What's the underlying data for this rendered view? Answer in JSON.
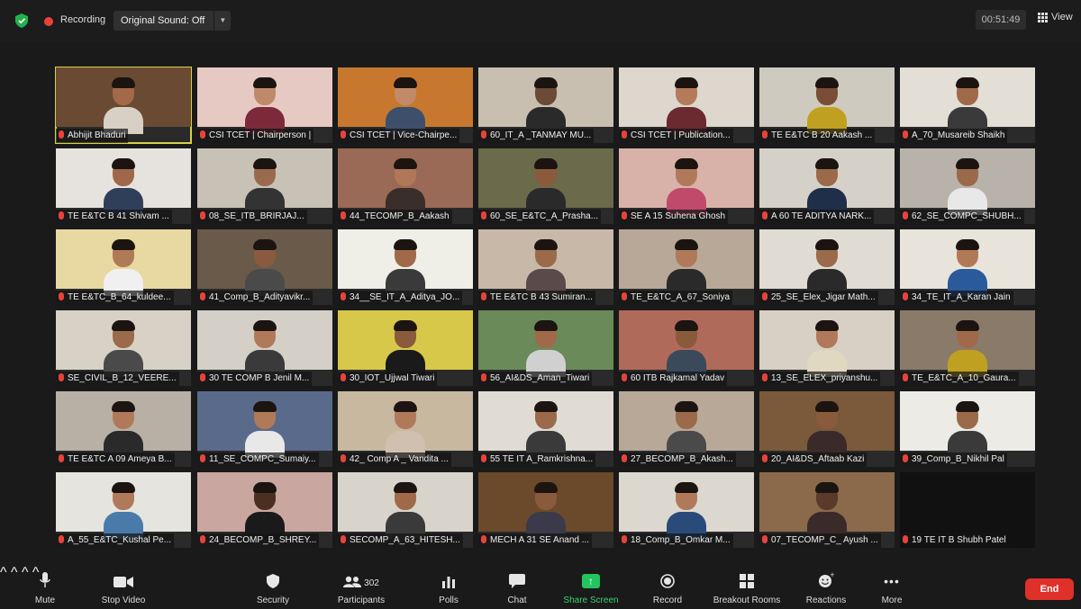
{
  "topbar": {
    "recording_label": "Recording",
    "original_sound": "Original Sound: Off",
    "timer": "00:51:49",
    "view_label": "View"
  },
  "participants": [
    {
      "name": "Abhijit Bhaduri",
      "bg": "#6b4a33",
      "skin": "#a36a48",
      "shirt": "#d8d0c4",
      "active": true
    },
    {
      "name": "CSI TCET | Chairperson |",
      "bg": "#e7c9c3",
      "skin": "#c08a6a",
      "shirt": "#7c2a3a"
    },
    {
      "name": "CSI TCET | Vice-Chairpe...",
      "bg": "#c7782e",
      "skin": "#c28a68",
      "shirt": "#3d4f6a"
    },
    {
      "name": "60_IT_A _TANMAY MU...",
      "bg": "#c9bfb0",
      "skin": "#6b4a38",
      "shirt": "#2a2a2a"
    },
    {
      "name": "CSI TCET | Publication...",
      "bg": "#ddd7ce",
      "skin": "#b47a5a",
      "shirt": "#6a2a30"
    },
    {
      "name": "TE E&TC B 20 Aakash ...",
      "bg": "#cfcac0",
      "skin": "#7a4e36",
      "shirt": "#c0a020"
    },
    {
      "name": "A_70_Musareib Shaikh",
      "bg": "#e3ded6",
      "skin": "#a06a4a",
      "shirt": "#3a3a3a"
    },
    {
      "name": "TE E&TC B 41 Shivam ...",
      "bg": "#e6e3de",
      "skin": "#a0684a",
      "shirt": "#2f3f5a"
    },
    {
      "name": "08_SE_ITB_BRIRJAJ...",
      "bg": "#c8c2b6",
      "skin": "#9a6a4e",
      "shirt": "#333"
    },
    {
      "name": "44_TECOMP_B_Aakash",
      "bg": "#9a6a56",
      "skin": "#b07858",
      "shirt": "#3a2e2a"
    },
    {
      "name": "60_SE_E&TC_A_Prasha...",
      "bg": "#6b6a4a",
      "skin": "#8a5a3c",
      "shirt": "#2a2a2a"
    },
    {
      "name": "SE A 15 Suhena Ghosh",
      "bg": "#d8b2a8",
      "skin": "#b07a5a",
      "shirt": "#c04a6a"
    },
    {
      "name": "A 60 TE ADITYA NARK...",
      "bg": "#d6d1c8",
      "skin": "#9a6a4a",
      "shirt": "#1f2f4a"
    },
    {
      "name": "62_SE_COMPC_SHUBH...",
      "bg": "#b8b2aa",
      "skin": "#9a6a4a",
      "shirt": "#e8e8e8"
    },
    {
      "name": "TE E&TC_B_64_kuldee...",
      "bg": "#e8d8a2",
      "skin": "#b07a54",
      "shirt": "#f0f0f0"
    },
    {
      "name": "41_Comp_B_Adityavikr...",
      "bg": "#6a5a4a",
      "skin": "#8a5a40",
      "shirt": "#4a4a4a"
    },
    {
      "name": "34__SE_IT_A_Aditya_JO...",
      "bg": "#efefe8",
      "skin": "#a06a4a",
      "shirt": "#3a3a3a"
    },
    {
      "name": "TE E&TC B 43 Sumiran...",
      "bg": "#c8b8a8",
      "skin": "#9a6a4a",
      "shirt": "#5a4a4a"
    },
    {
      "name": "TE_E&TC_A_67_Soniya",
      "bg": "#b8a898",
      "skin": "#b07a5a",
      "shirt": "#2a2a2a"
    },
    {
      "name": "25_SE_Elex_Jigar Math...",
      "bg": "#e0dcd4",
      "skin": "#9a6a4a",
      "shirt": "#2a2a2a"
    },
    {
      "name": "34_TE_IT_A_Karan Jain",
      "bg": "#e8e4dc",
      "skin": "#b07a56",
      "shirt": "#2a5a9a"
    },
    {
      "name": "SE_CIVIL_B_12_VEERE...",
      "bg": "#d8d2c6",
      "skin": "#9a6a4a",
      "shirt": "#4a4a4a"
    },
    {
      "name": "30 TE COMP B Jenil M...",
      "bg": "#d4d0c8",
      "skin": "#b07a5a",
      "shirt": "#3a3a3a"
    },
    {
      "name": "30_IOT_Ujjwal Tiwari",
      "bg": "#d8c84a",
      "skin": "#8a5a3c",
      "shirt": "#1a1a1a"
    },
    {
      "name": "56_AI&DS_Aman_Tiwari",
      "bg": "#6a8a5a",
      "skin": "#a06a4a",
      "shirt": "#d0d0d0"
    },
    {
      "name": "60 ITB Rajkamal Yadav",
      "bg": "#b06a5a",
      "skin": "#8a5a3c",
      "shirt": "#3a4a5a"
    },
    {
      "name": "13_SE_ELEX_priyanshu...",
      "bg": "#d8d0c4",
      "skin": "#b07a5a",
      "shirt": "#e0d8c0"
    },
    {
      "name": "TE_E&TC_A_10_Gaura...",
      "bg": "#8a7a6a",
      "skin": "#a06a4a",
      "shirt": "#c0a020"
    },
    {
      "name": "TE E&TC A 09 Ameya B...",
      "bg": "#b8b0a4",
      "skin": "#b07a5a",
      "shirt": "#2a2a2a"
    },
    {
      "name": "11_SE_COMPC_Sumaiy...",
      "bg": "#5a6a8a",
      "skin": "#b07a5a",
      "shirt": "#e8e8e8"
    },
    {
      "name": "42_ Comp A _ Vandita ...",
      "bg": "#c8b8a0",
      "skin": "#b07a5a",
      "shirt": "#d0c0b0"
    },
    {
      "name": "55 TE IT A_Ramkrishna...",
      "bg": "#e0dcd4",
      "skin": "#9a6a4a",
      "shirt": "#3a3a3a"
    },
    {
      "name": "27_BECOMP_B_Akash...",
      "bg": "#b8a898",
      "skin": "#9a6a4a",
      "shirt": "#4a4a4a"
    },
    {
      "name": "20_AI&DS_Aftaab Kazi",
      "bg": "#7a5a3a",
      "skin": "#8a5a3c",
      "shirt": "#3a2a2a"
    },
    {
      "name": "39_Comp_B_Nikhil Pal",
      "bg": "#ecebe6",
      "skin": "#9a6a4a",
      "shirt": "#3a3a3a"
    },
    {
      "name": "A_55_E&TC_Kushal Pe...",
      "bg": "#e6e4de",
      "skin": "#b07a5a",
      "shirt": "#4a7aaa"
    },
    {
      "name": "24_BECOMP_B_SHREY...",
      "bg": "#caa6a0",
      "skin": "#4a3020",
      "shirt": "#1a1a1a"
    },
    {
      "name": "SECOMP_A_63_HITESH...",
      "bg": "#d8d4cc",
      "skin": "#a06a4a",
      "shirt": "#3a3a3a"
    },
    {
      "name": "MECH A 31 SE Anand ...",
      "bg": "#6a4a2a",
      "skin": "#8a5a3c",
      "shirt": "#3a3a4a"
    },
    {
      "name": "18_Comp_B_Omkar M...",
      "bg": "#dcd8d0",
      "skin": "#b07a5a",
      "shirt": "#2a4a7a"
    },
    {
      "name": "07_TECOMP_C_ Ayush ...",
      "bg": "#8a6a4a",
      "skin": "#5a3a2a",
      "shirt": "#3a2a2a"
    },
    {
      "name": "19 TE IT B Shubh Patel",
      "bg": "#111111",
      "video_off": true
    }
  ],
  "toolbar": {
    "mute": "Mute",
    "stop_video": "Stop Video",
    "security": "Security",
    "participants": "Participants",
    "participants_count": "302",
    "polls": "Polls",
    "chat": "Chat",
    "share_screen": "Share Screen",
    "record": "Record",
    "breakout_rooms": "Breakout Rooms",
    "reactions": "Reactions",
    "more": "More",
    "end": "End"
  },
  "colors": {
    "accent_green": "#22c55e",
    "end_red": "#e0302a",
    "active_speaker": "#d4d24a",
    "rec_red": "#e8433b"
  },
  "icons": [
    "shield-icon",
    "record-dot-icon",
    "chevron-down-icon",
    "view-grid-icon",
    "microphone-icon",
    "video-camera-icon",
    "security-shield-icon",
    "participants-icon",
    "polls-icon",
    "chat-icon",
    "share-screen-icon",
    "record-icon",
    "breakout-rooms-icon",
    "reactions-icon",
    "more-icon",
    "muted-mic-icon"
  ]
}
